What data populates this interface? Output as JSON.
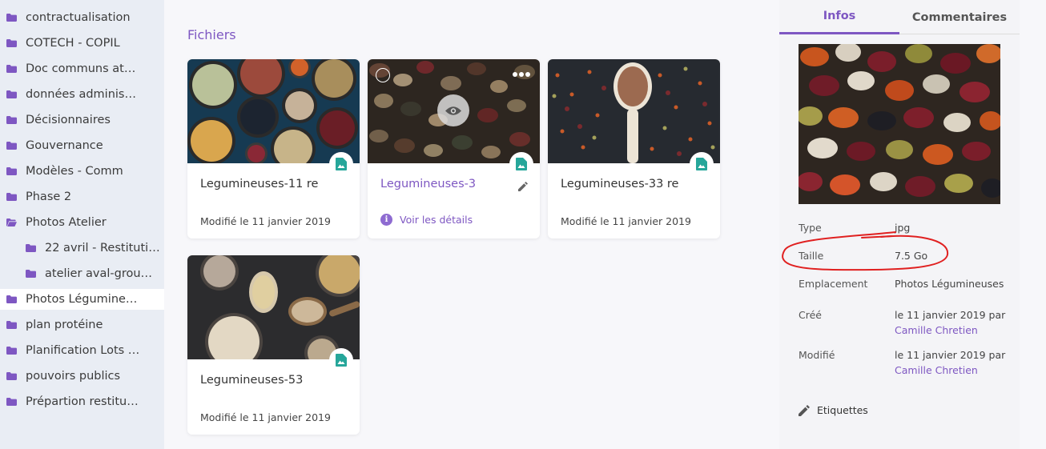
{
  "sidebar": {
    "items": [
      {
        "label": "contractualisation"
      },
      {
        "label": "COTECH - COPIL"
      },
      {
        "label": "Doc communs at…"
      },
      {
        "label": "données adminis…"
      },
      {
        "label": "Décisionnaires"
      },
      {
        "label": "Gouvernance"
      },
      {
        "label": "Modèles - Comm"
      },
      {
        "label": "Phase 2"
      },
      {
        "label": "Photos Atelier"
      },
      {
        "label": "22 avril - Restituti…"
      },
      {
        "label": "atelier aval-grou…"
      },
      {
        "label": "Photos Légumine…"
      },
      {
        "label": "plan protéine"
      },
      {
        "label": "Planification Lots …"
      },
      {
        "label": "pouvoirs publics"
      },
      {
        "label": "Prépartion restitu…"
      }
    ]
  },
  "main": {
    "section_title": "Fichiers",
    "cards": [
      {
        "title": "Legumineuses-11 re",
        "meta": "Modifié le 11 janvier 2019"
      },
      {
        "title": "Legumineuses-3",
        "details": "Voir les détails"
      },
      {
        "title": "Legumineuses-33 re",
        "meta": "Modifié le 11 janvier 2019"
      },
      {
        "title": "Legumineuses-53",
        "meta": "Modifié le 11 janvier 2019"
      }
    ]
  },
  "panel": {
    "tabs": [
      {
        "label": "Infos"
      },
      {
        "label": "Commentaires"
      }
    ],
    "props": {
      "type_label": "Type",
      "type_value": "jpg",
      "size_label": "Taille",
      "size_value": "7.5 Go",
      "location_label": "Emplacement",
      "location_value": "Photos Légumineuses",
      "created_label": "Créé",
      "created_value": "le 11 janvier 2019 par",
      "created_by": "Camille Chretien",
      "modified_label": "Modifié",
      "modified_value": "le 11 janvier 2019 par",
      "modified_by": "Camille Chretien"
    },
    "tags_label": "Etiquettes"
  },
  "colors": {
    "accent": "#7e57c2",
    "folder": "#7e57c2",
    "image_badge": "#26a69a",
    "annotation": "#e02020"
  },
  "icons": {
    "folder": "folder-icon",
    "folder_open": "folder-open-icon",
    "image": "image-icon",
    "info": "info-icon",
    "edit": "pencil-icon",
    "eye": "eye-icon",
    "more": "more-horizontal-icon",
    "select": "select-circle-icon"
  }
}
